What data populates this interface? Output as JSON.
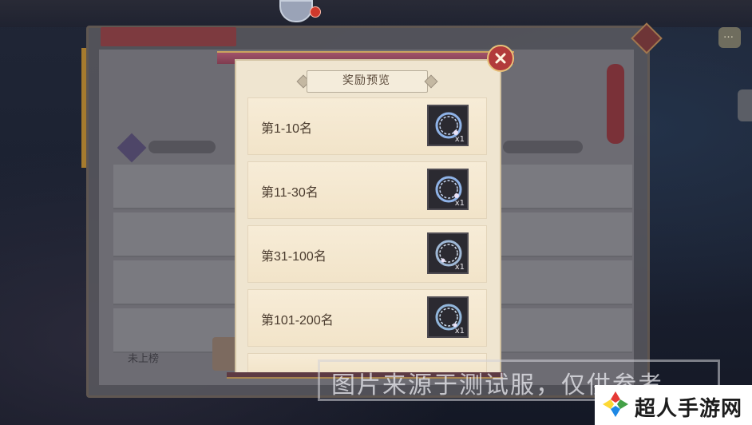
{
  "background": {
    "chat_glyph": "…",
    "bottom_label": "未上榜"
  },
  "modal": {
    "title": "奖励预览",
    "close_icon": "close-x-icon",
    "ranks": [
      {
        "label": "第1-10名",
        "item_icon": "ring-icon",
        "qty": "x1"
      },
      {
        "label": "第11-30名",
        "item_icon": "ring-icon",
        "qty": "x1"
      },
      {
        "label": "第31-100名",
        "item_icon": "ring-icon",
        "qty": "x1"
      },
      {
        "label": "第101-200名",
        "item_icon": "ring-icon",
        "qty": "x1"
      }
    ]
  },
  "watermark": {
    "text": "图片来源于测试服，仅供参考"
  },
  "site": {
    "name": "超人手游网"
  },
  "colors": {
    "modal_bg": "#efe5d0",
    "card_bg": "#f4e7cf",
    "close_red": "#b23b3b",
    "slot_dark": "#2b2a31"
  }
}
